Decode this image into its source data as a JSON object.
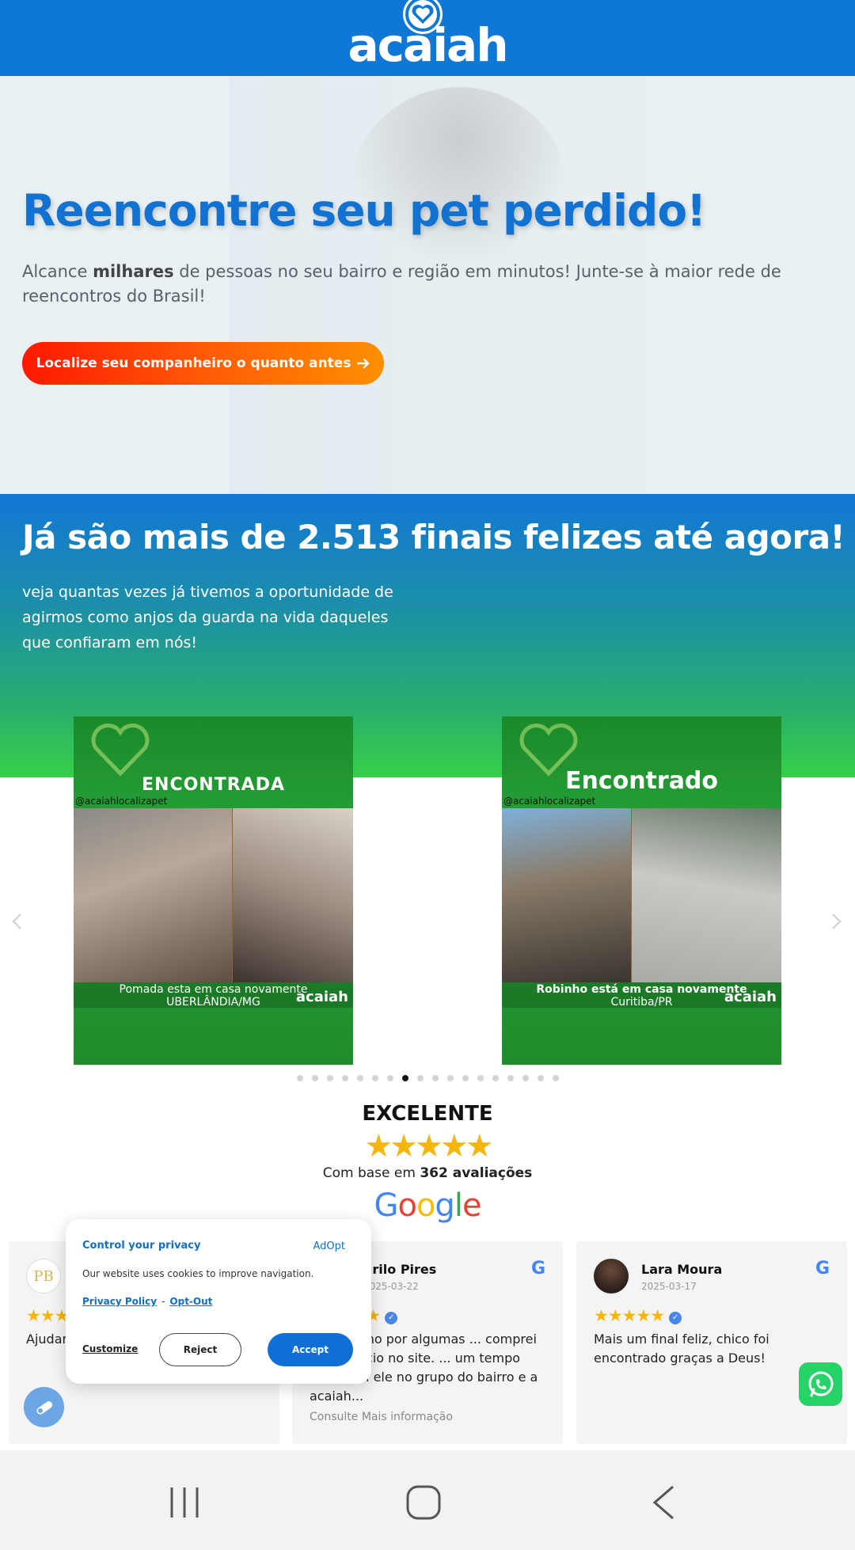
{
  "header": {
    "logo_text": "acaiah"
  },
  "hero": {
    "title": "Reencontre seu pet perdido!",
    "subtitle_pre": "Alcance ",
    "subtitle_bold": "milhares",
    "subtitle_post": " de pessoas no seu bairro e região em minutos! Junte-se à maior rede de reencontros do Brasil!",
    "cta_label": "Localize seu companheiro o quanto antes",
    "cta_icon": "arrow-right-icon"
  },
  "stats": {
    "title": "Já são mais de 2.513 finais felizes até agora!",
    "subtitle": "veja quantas vezes já tivemos a oportunidade de agirmos como anjos da guarda na vida daqueles que confiaram em nós!"
  },
  "carousel": {
    "cards": [
      {
        "title": "ENCONTRADA",
        "handle": "@acaiahlocalizapet",
        "caption_line1": "Pomada esta em casa novamente",
        "caption_line2": "UBERLÂNDIA/MG",
        "brand": "acaiah"
      },
      {
        "title": "Encontrado",
        "handle": "@acaiahlocalizapet",
        "caption_line1": "Robinho está em casa novamente",
        "caption_line2": "Curitiba/PR",
        "brand": "acaiah"
      }
    ],
    "prev_icon": "chevron-left-icon",
    "next_icon": "chevron-right-icon",
    "dot_count": 18,
    "active_dot": 7
  },
  "reviews_summary": {
    "rating_label": "EXCELENTE",
    "stars": 5,
    "based_pre": "Com base em ",
    "based_bold": "362 avaliações",
    "provider": "Google"
  },
  "reviews": [
    {
      "name": "",
      "date": "",
      "stars": 5,
      "text": "Ajudar... minha... encontr...",
      "more": ""
    },
    {
      "name": "urilo Pires",
      "date": "2025-03-22",
      "stars": 5,
      "text": "... cãozinho por algumas ... comprei um anúncio no site. ... um tempo encontrei ele no grupo do bairro e a acaiah...",
      "more": "Consulte Mais informação"
    },
    {
      "name": "Lara Moura",
      "date": "2025-03-17",
      "stars": 5,
      "text": "Mais um final feliz, chico foi encontrado graças a Deus!",
      "more": ""
    }
  ],
  "cookie": {
    "title": "Control your privacy",
    "brand": "AdOpt",
    "text": "Our website uses cookies to improve navigation.",
    "privacy_link": "Privacy Policy",
    "separator": "-",
    "optout_link": "Opt-Out",
    "customize": "Customize",
    "reject": "Reject",
    "accept": "Accept"
  },
  "colors": {
    "brand_blue": "#0f78d6",
    "cta_orange": "#ff5a08",
    "star_gold": "#f5b50d",
    "whatsapp_green": "#25d366"
  }
}
